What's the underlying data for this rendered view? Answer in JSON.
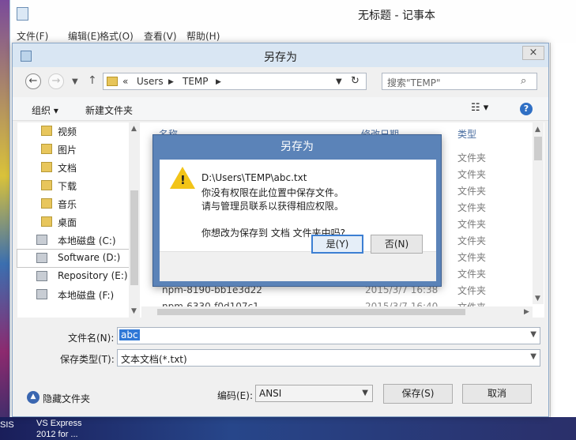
{
  "notepad": {
    "title": "无标题 - 记事本",
    "menu": [
      "文件(F)",
      "编辑(E)",
      "格式(O)",
      "查看(V)",
      "帮助(H)"
    ]
  },
  "desktop": {
    "bottom_labels": [
      "SIS",
      "VS Express",
      "2012 for ..."
    ]
  },
  "save_dialog": {
    "title": "另存为",
    "close": "×",
    "address": {
      "prefix": "«",
      "segments": [
        "Users",
        "TEMP"
      ]
    },
    "search_placeholder": "搜索\"TEMP\"",
    "toolbar": {
      "organize": "组织 ▾",
      "new_folder": "新建文件夹"
    },
    "tree": [
      {
        "label": "视频",
        "icon": "video-folder-icon"
      },
      {
        "label": "图片",
        "icon": "pictures-folder-icon"
      },
      {
        "label": "文档",
        "icon": "documents-folder-icon"
      },
      {
        "label": "下载",
        "icon": "downloads-folder-icon"
      },
      {
        "label": "音乐",
        "icon": "music-folder-icon"
      },
      {
        "label": "桌面",
        "icon": "desktop-folder-icon"
      },
      {
        "label": "本地磁盘 (C:)",
        "icon": "drive-icon"
      },
      {
        "label": "Software (D:)",
        "icon": "drive-icon",
        "selected": true
      },
      {
        "label": "Repository (E:)",
        "icon": "drive-icon"
      },
      {
        "label": "本地磁盘 (F:)",
        "icon": "drive-icon"
      }
    ],
    "columns": {
      "name": "名称",
      "modified": "修改日期",
      "type": "类型"
    },
    "rows_type": [
      "文件夹",
      "文件夹",
      "文件夹",
      "文件夹",
      "文件夹",
      "文件夹",
      "文件夹",
      "文件夹",
      "文件夹",
      "文件夹",
      "文件夹"
    ],
    "partial_rows": [
      {
        "name": "npm-8190-bb1e3d22",
        "date": "2015/3/7 16:38"
      },
      {
        "name": "npm-6330-f0d107c1",
        "date": "2015/3/7 16:40"
      }
    ],
    "filename_label": "文件名(N):",
    "filename_value": "abc",
    "filetype_label": "保存类型(T):",
    "filetype_value": "文本文档(*.txt)",
    "hide_folders": "隐藏文件夹",
    "encoding_label": "编码(E):",
    "encoding_value": "ANSI",
    "save_button": "保存(S)",
    "cancel_button": "取消"
  },
  "warning_dialog": {
    "title": "另存为",
    "lines": [
      "D:\\Users\\TEMP\\abc.txt",
      "你没有权限在此位置中保存文件。",
      "请与管理员联系以获得相应权限。",
      "",
      "你想改为保存到 文档 文件夹中吗?"
    ],
    "yes_button": "是(Y)",
    "no_button": "否(N)"
  }
}
